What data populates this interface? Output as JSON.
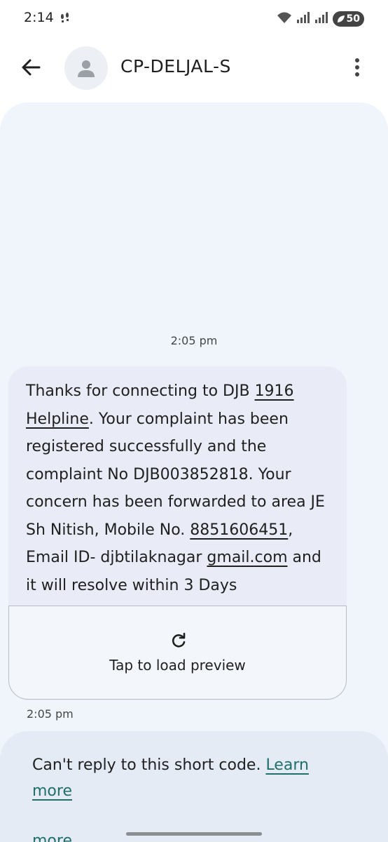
{
  "status_bar": {
    "time": "2:14",
    "battery": "50"
  },
  "header": {
    "contact_name": "CP-DELJAL-S"
  },
  "conversation": {
    "timestamp": "2:05 pm",
    "message": {
      "segments": [
        {
          "text": "Thanks for connecting to DJB ",
          "link": false
        },
        {
          "text": "1916 Helpline",
          "link": true
        },
        {
          "text": ". Your complaint has been registered successfully and the complaint No DJB003852818. Your concern has been forwarded to area JE Sh Nitish, Mobile No. ",
          "link": false
        },
        {
          "text": "8851606451",
          "link": true
        },
        {
          "text": ", Email ID- djbtilaknagar ",
          "link": false
        },
        {
          "text": "gmail.com",
          "link": true
        },
        {
          "text": " and it will resolve within 3 Days",
          "link": false
        }
      ],
      "preview_label": "Tap to load preview",
      "time": "2:05 pm"
    }
  },
  "reply_panel": {
    "text": "Can't reply to this short code. ",
    "link": "Learn more",
    "trailing": "more"
  }
}
